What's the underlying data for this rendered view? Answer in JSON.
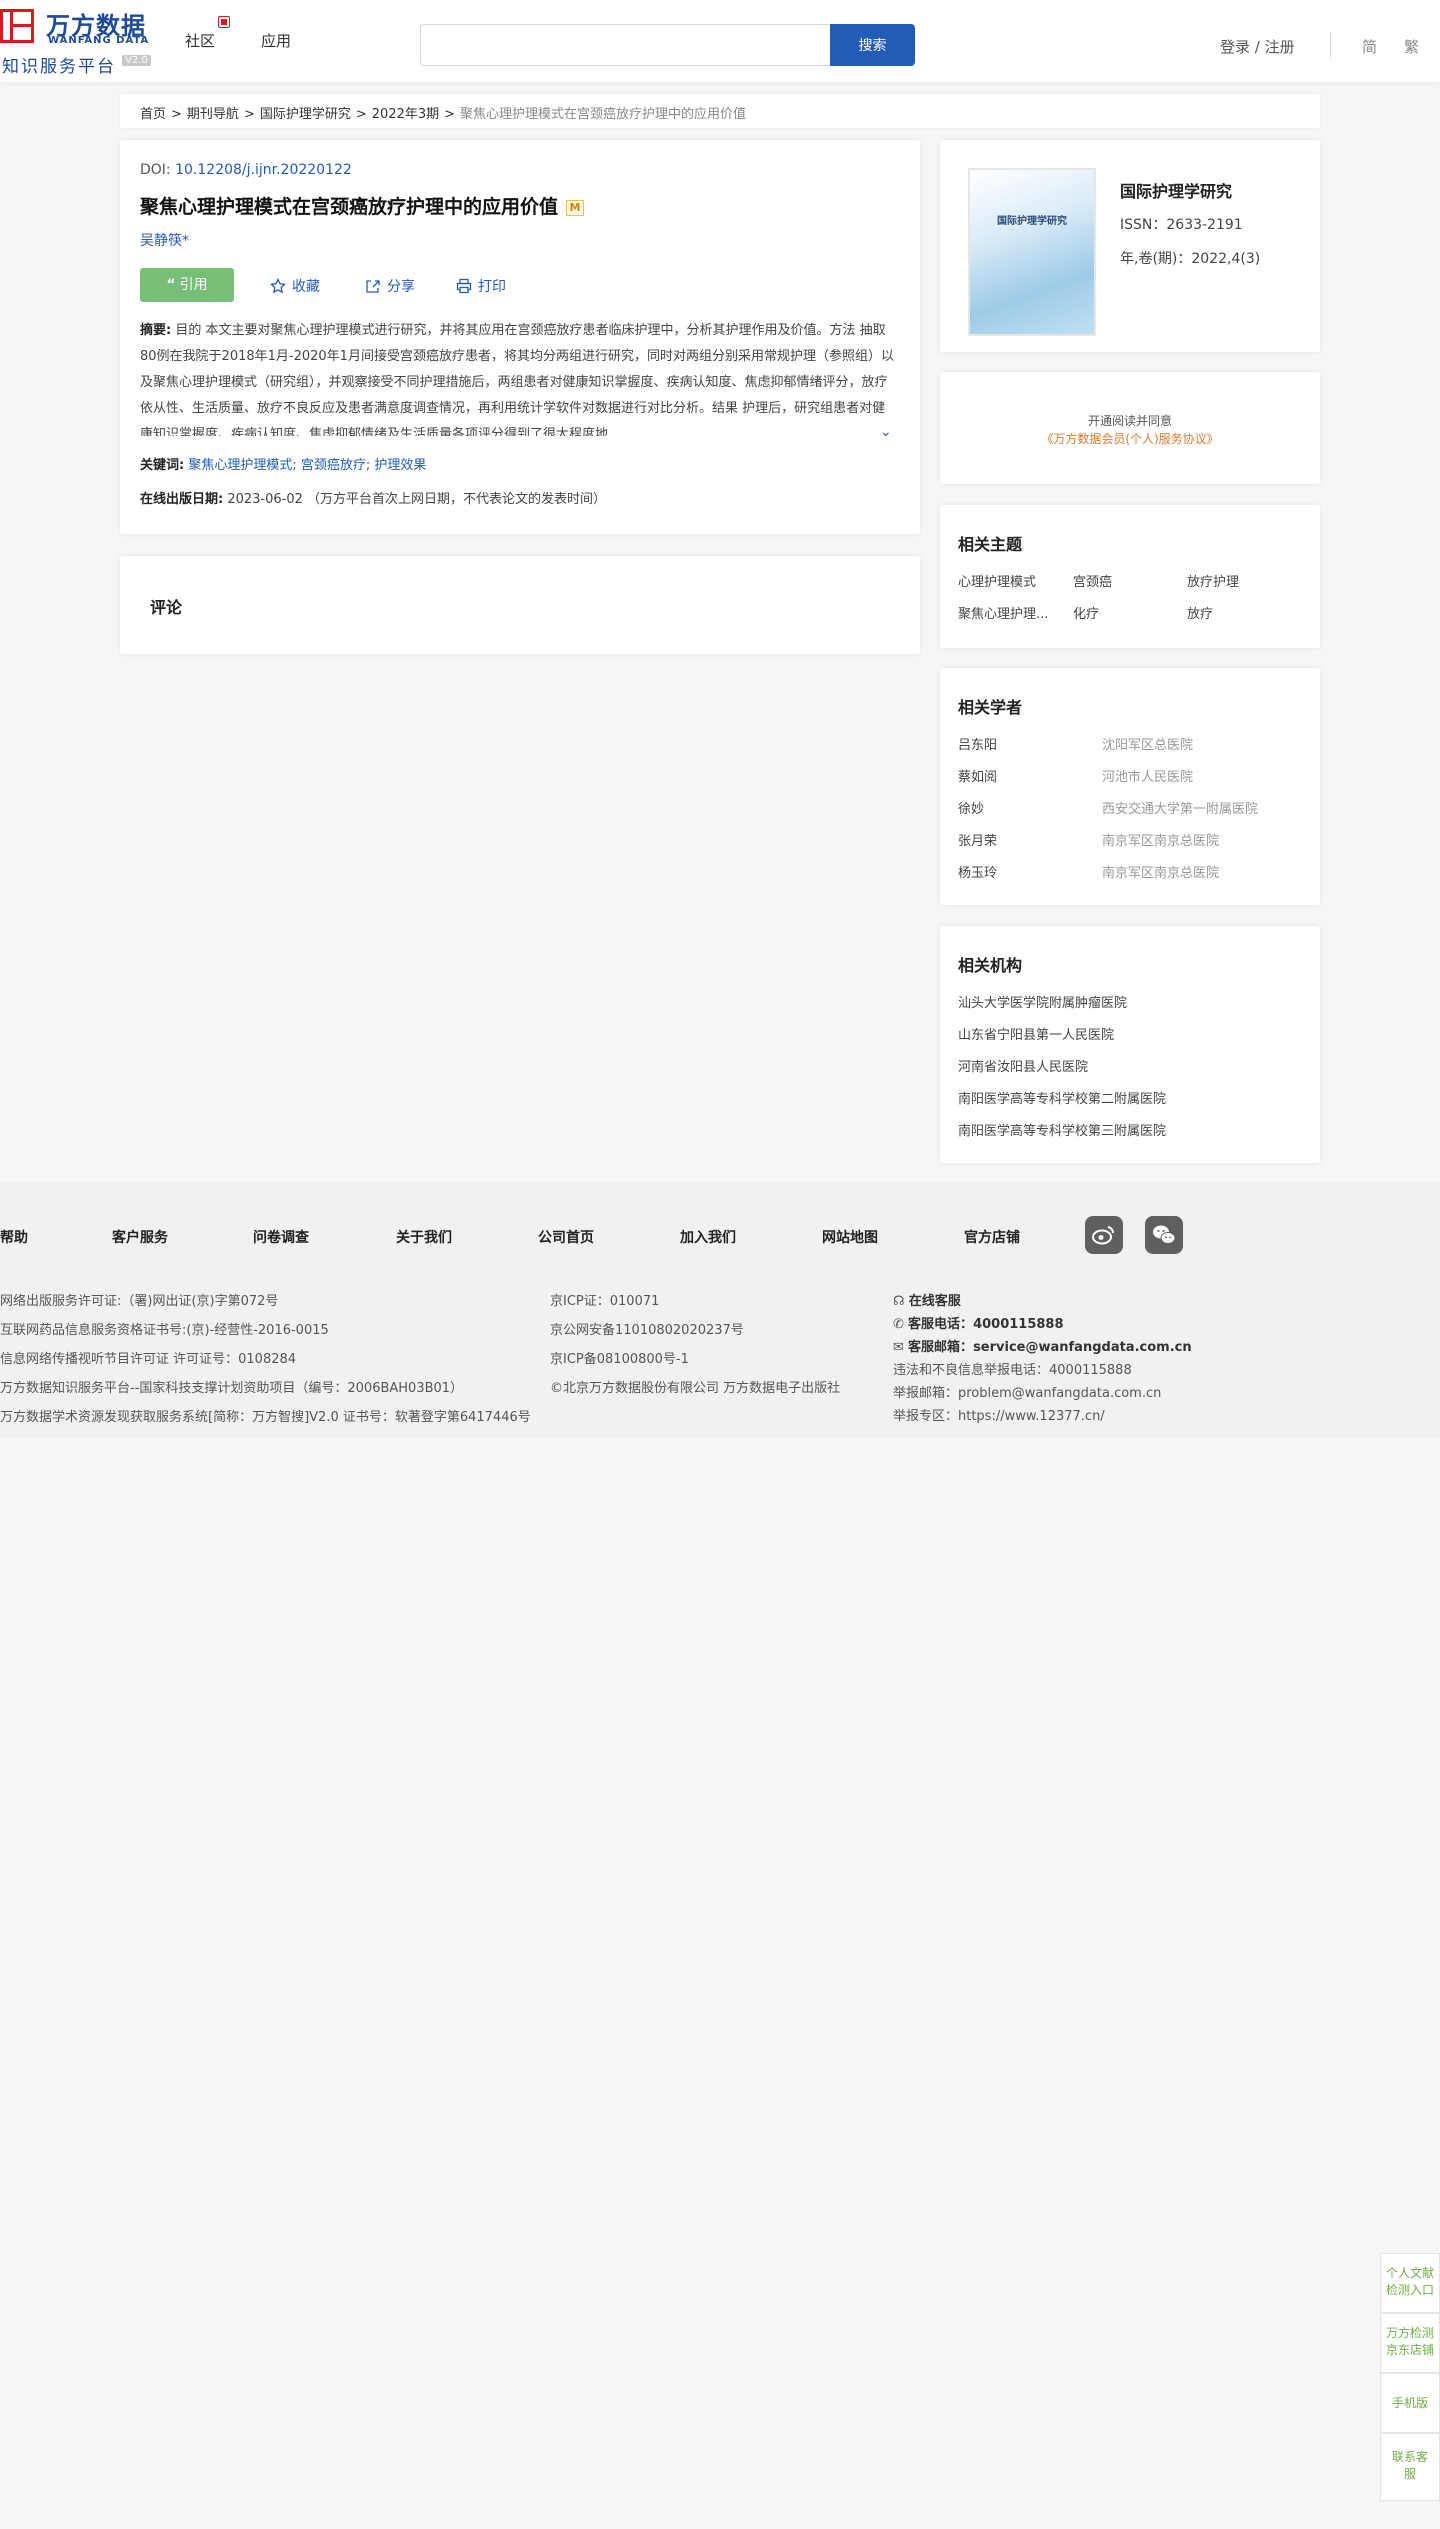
{
  "header": {
    "logo_cn": "万方数据",
    "logo_en": "WANFANG DATA",
    "logo_sub": "知识服务平台",
    "logo_ver": "V2.0",
    "nav": [
      "社区",
      "应用"
    ],
    "search_placeholder": "",
    "search_button": "搜索",
    "login": "登录 / 注册",
    "lang_simplified": "简",
    "lang_traditional": "繁"
  },
  "breadcrumb": {
    "items": [
      "首页",
      "期刊导航",
      "国际护理学研究",
      "2022年3期"
    ],
    "current": "聚焦心理护理模式在宫颈癌放疗护理中的应用价值",
    "sep": ">"
  },
  "article": {
    "doi_label": "DOI:",
    "doi": "10.12208/j.ijnr.20220122",
    "title": "聚焦心理护理模式在宫颈癌放疗护理中的应用价值",
    "m_badge": "M",
    "author": "吴静筷*",
    "actions": {
      "cite": "引用",
      "favorite": "收藏",
      "share": "分享",
      "print": "打印"
    },
    "abstract_label": "摘要:",
    "abstract": "目的 本文主要对聚焦心理护理模式进行研究，并将其应用在宫颈癌放疗患者临床护理中，分析其护理作用及价值。方法 抽取80例在我院于2018年1月-2020年1月间接受宫颈癌放疗患者，将其均分两组进行研究，同时对两组分别采用常规护理（参照组）以及聚焦心理护理模式（研究组），并观察接受不同护理措施后，两组患者对健康知识掌握度、疾病认知度、焦虑抑郁情绪评分，放疗依从性、生活质量、放疗不良反应及患者满意度调查情况，再利用统计学软件对数据进行对比分析。结果 护理后，研究组患者对健康知识掌握度、疾病认知度、焦虑抑郁情绪及生活质量各项评分得到了很大程度地...",
    "keywords_label": "关键词:",
    "keywords": [
      "聚焦心理护理模式;",
      "宫颈癌放疗;",
      "护理效果"
    ],
    "pubdate_label": "在线出版日期:",
    "pubdate": "2023-06-02",
    "pubdate_note": "（万方平台首次上网日期，不代表论文的发表时间）"
  },
  "comment": {
    "title": "评论"
  },
  "journal": {
    "cover_text": "国际护理学研究",
    "name": "国际护理学研究",
    "issn": "ISSN：2633-2191",
    "volume": "年,卷(期)：2022,4(3)"
  },
  "open_read": {
    "line1": "开通阅读并同意",
    "line2": "《万方数据会员(个人)服务协议》"
  },
  "related_topics": {
    "title": "相关主题",
    "items": [
      "心理护理模式",
      "宫颈癌",
      "放疗护理",
      "聚焦心理护理...",
      "化疗",
      "放疗"
    ]
  },
  "related_scholars": {
    "title": "相关学者",
    "items": [
      {
        "name": "吕东阳",
        "org": "沈阳军区总医院"
      },
      {
        "name": "蔡如阅",
        "org": "河池市人民医院"
      },
      {
        "name": "徐妙",
        "org": "西安交通大学第一附属医院"
      },
      {
        "name": "张月荣",
        "org": "南京军区南京总医院"
      },
      {
        "name": "杨玉玲",
        "org": "南京军区南京总医院"
      }
    ]
  },
  "related_institutions": {
    "title": "相关机构",
    "items": [
      "汕头大学医学院附属肿瘤医院",
      "山东省宁阳县第一人民医院",
      "河南省汝阳县人民医院",
      "南阳医学高等专科学校第二附属医院",
      "南阳医学高等专科学校第三附属医院"
    ]
  },
  "footer": {
    "links": [
      "帮助",
      "客户服务",
      "问卷调查",
      "关于我们",
      "公司首页",
      "加入我们",
      "网站地图",
      "官方店铺"
    ],
    "col1": [
      "网络出版服务许可证:（署)网出证(京)字第072号",
      "互联网药品信息服务资格证书号:(京)-经营性-2016-0015",
      "信息网络传播视听节目许可证 许可证号：0108284",
      "万方数据知识服务平台--国家科技支撑计划资助项目（编号：2006BAH03B01）",
      "万方数据学术资源发现获取服务系统[简称：万方智搜]V2.0 证书号：软著登字第6417446号"
    ],
    "col2": [
      "京ICP证：010071",
      "京公网安备11010802020237号",
      "京ICP备08100800号-1",
      "©北京万方数据股份有限公司 万方数据电子出版社"
    ],
    "service_online": "在线客服",
    "phone_label": "客服电话：",
    "phone": "4000115888",
    "email_label": "客服邮箱：",
    "email": "service@wanfangdata.com.cn",
    "report_phone": "违法和不良信息举报电话：4000115888",
    "report_email": "举报邮箱：problem@wanfangdata.com.cn",
    "report_zone": "举报专区：https://www.12377.cn/"
  },
  "side_tools": [
    "个人文献检测入口",
    "万方检测京东店铺",
    "手机版",
    "联系客服"
  ]
}
